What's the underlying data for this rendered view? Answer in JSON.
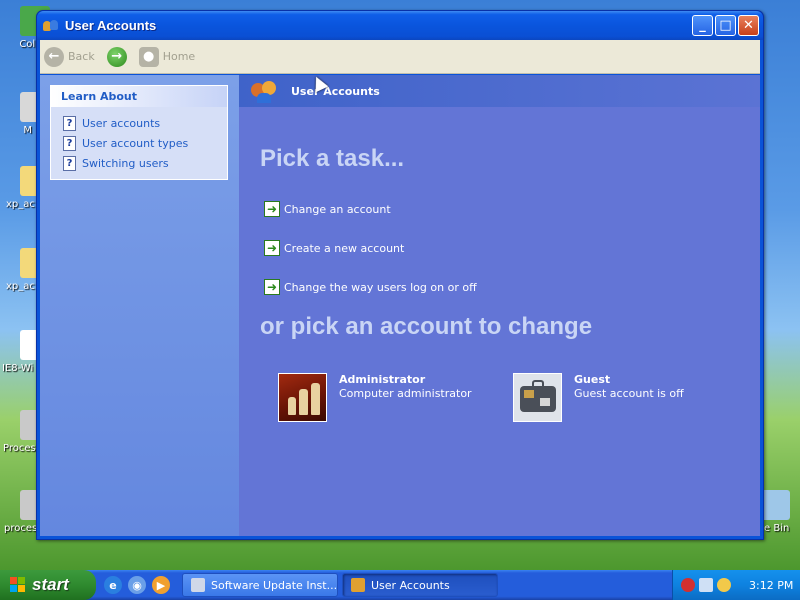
{
  "desktop": {
    "icons": [
      {
        "label": "Coll"
      },
      {
        "label": "M"
      },
      {
        "label": "xp_ac"
      },
      {
        "label": "xp_ac"
      },
      {
        "label": "IE8-Wi"
      },
      {
        "label": "Proces"
      },
      {
        "label": "proces"
      },
      {
        "label": "e Bin"
      }
    ]
  },
  "window": {
    "title": "User Accounts",
    "toolbar": {
      "back_label": "Back",
      "home_label": "Home"
    },
    "learn_about": {
      "heading": "Learn About",
      "items": [
        {
          "label": "User accounts"
        },
        {
          "label": "User account types"
        },
        {
          "label": "Switching users"
        }
      ]
    },
    "header_title": "User Accounts",
    "pick_task_heading": "Pick a task...",
    "tasks": [
      {
        "label": "Change an account"
      },
      {
        "label": "Create a new account"
      },
      {
        "label": "Change the way users log on or off"
      }
    ],
    "pick_account_heading": "or pick an account to change",
    "accounts": [
      {
        "name": "Administrator",
        "description": "Computer administrator"
      },
      {
        "name": "Guest",
        "description": "Guest account is off"
      }
    ]
  },
  "taskbar": {
    "start_label": "start",
    "buttons": [
      {
        "label": "Software Update Inst..."
      },
      {
        "label": "User Accounts"
      }
    ],
    "clock": "3:12 PM"
  },
  "colors": {
    "title_bar": "#0a55dd",
    "main_pane": "#6375d6",
    "left_pane": "#7ca0e8",
    "start_button": "#2f8a2f"
  }
}
